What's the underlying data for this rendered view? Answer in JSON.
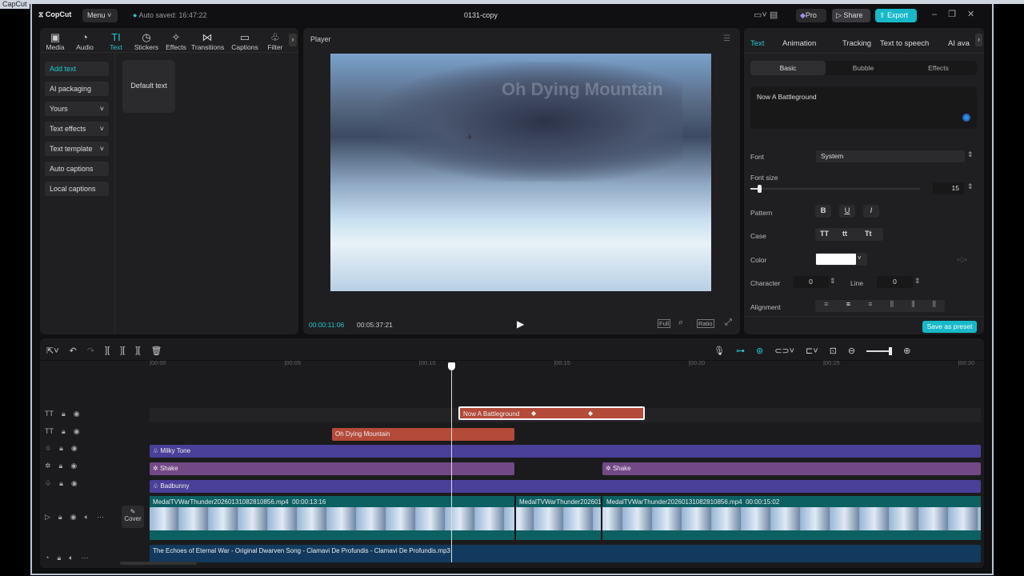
{
  "window": {
    "corner_title": "CapCut",
    "app_name": "CopCut",
    "menu_label": "Menu",
    "autosave": "Auto saved: 16:47:22",
    "project_title": "0131-copy",
    "pro_label": "Pro",
    "share_label": "Share",
    "export_label": "Export"
  },
  "toolbar": {
    "items": [
      {
        "icon": "media-icon",
        "glyph": "▣",
        "label": "Media"
      },
      {
        "icon": "audio-icon",
        "glyph": "◔",
        "label": "Audio"
      },
      {
        "icon": "text-icon",
        "glyph": "TI",
        "label": "Text"
      },
      {
        "icon": "stickers-icon",
        "glyph": "◷",
        "label": "Stickers"
      },
      {
        "icon": "effects-icon",
        "glyph": "✧",
        "label": "Effects"
      },
      {
        "icon": "transitions-icon",
        "glyph": "⋈",
        "label": "Transitions"
      },
      {
        "icon": "captions-icon",
        "glyph": "▭",
        "label": "Captions"
      },
      {
        "icon": "filters-icon",
        "glyph": "♧",
        "label": "Filter"
      }
    ]
  },
  "left_menu": {
    "items": [
      "Add text",
      "AI packaging",
      "Yours",
      "Text effects",
      "Text template",
      "Auto captions",
      "Local captions"
    ],
    "card": "Default text"
  },
  "player": {
    "title": "Player",
    "overlay_text": "Oh Dying Mountain",
    "current_time": "00:00:11:06",
    "total_time": "00:05:37:21",
    "full": "Full",
    "ratio": "Ratio"
  },
  "right": {
    "tabs": [
      "Text",
      "Animation",
      "Tracking",
      "Text to speech",
      "AI ava"
    ],
    "subtabs": [
      "Basic",
      "Bubble",
      "Effects"
    ],
    "text_value": "Now A Battleground",
    "font_label": "Font",
    "font_value": "System",
    "font_size_label": "Font size",
    "font_size": "15",
    "font_size_fraction": 0.05,
    "pattern_label": "Pattern",
    "pattern": [
      "B",
      "U",
      "I"
    ],
    "case_label": "Case",
    "case": [
      "TT",
      "tt",
      "Tt"
    ],
    "color_label": "Color",
    "color_value": "#ffffff",
    "character_label": "Character",
    "character": "0",
    "line_label": "Line",
    "line": "0",
    "alignment_label": "Alignment",
    "save_preset": "Save as preset"
  },
  "timeline": {
    "ticks": [
      "00:00",
      "00:05",
      "00:10",
      "00:15",
      "00:20",
      "00:25",
      "00:30"
    ],
    "cover": "Cover",
    "clips": {
      "text1": "Now A Battleground",
      "text2": "Oh Dying Mountain",
      "filter1": "Milky Tone",
      "effect1": "Shake",
      "effect2": "Shake",
      "filter2": "Badbunny",
      "video1": "MedalTVWarThunder20260131082810856.mp4",
      "video1_dur": "00:00:13:16",
      "video2": "MedalTVWarThunder202601",
      "video3": "MedalTVWarThunder20260131082810856.mp4",
      "video3_dur": "00:00:15:02",
      "audio": "The Echoes of Eternal War - Original Dwarven Song - Clamavi De Profundis - Clamavi De Profundis.mp3"
    }
  }
}
